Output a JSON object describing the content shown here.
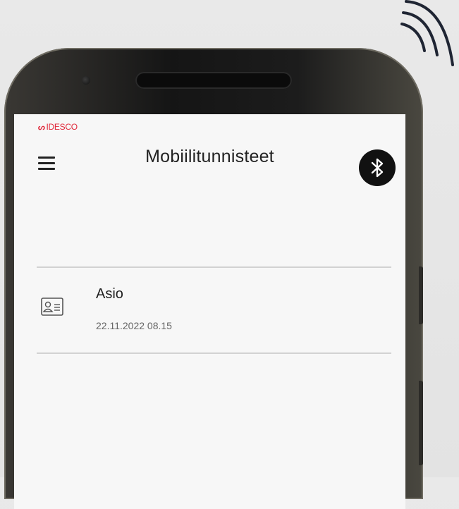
{
  "brand": {
    "mark": "ᔕ",
    "name": "IDESCO"
  },
  "header": {
    "title": "Mobiilitunnisteet"
  },
  "icons": {
    "menu": "hamburger-menu-icon",
    "bluetooth": "bluetooth-icon",
    "credential": "id-card-icon",
    "wireless": "nfc-waves-icon"
  },
  "credentials": [
    {
      "name": "Asio",
      "date": "22.11.2022 08.15"
    }
  ],
  "colors": {
    "brand": "#e0283a",
    "screen_bg": "#f7f7f7",
    "bluetooth_bg": "#111111"
  }
}
